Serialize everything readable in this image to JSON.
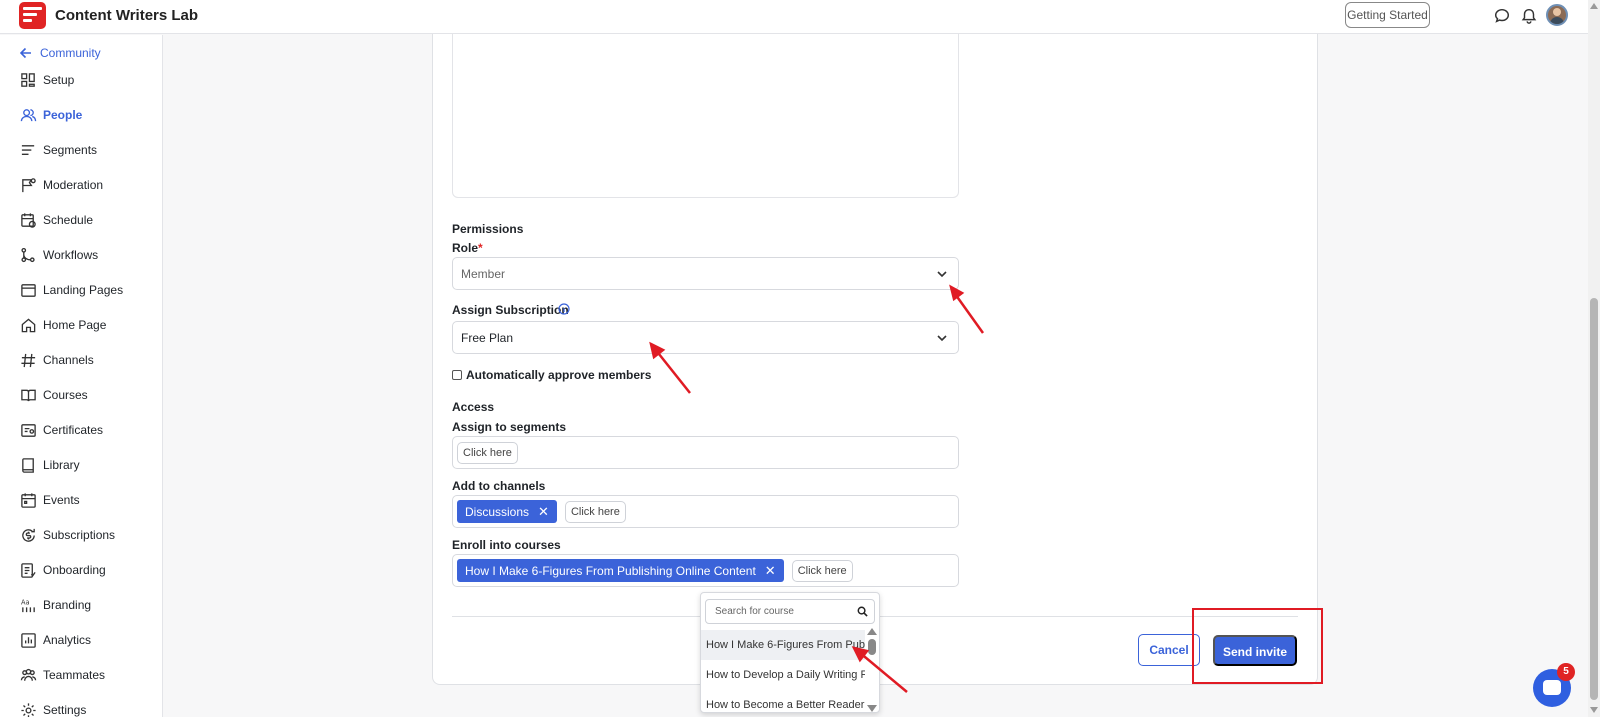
{
  "app": {
    "title": "Content Writers Lab"
  },
  "header": {
    "getting_started": "Getting Started"
  },
  "sidebar": {
    "back_label": "Community",
    "items": [
      {
        "label": "Setup",
        "icon": "grid-icon"
      },
      {
        "label": "People",
        "icon": "people-icon",
        "active": true
      },
      {
        "label": "Segments",
        "icon": "segments-icon"
      },
      {
        "label": "Moderation",
        "icon": "flag-icon"
      },
      {
        "label": "Schedule",
        "icon": "calendar-clock-icon"
      },
      {
        "label": "Workflows",
        "icon": "workflow-icon"
      },
      {
        "label": "Landing Pages",
        "icon": "browser-icon"
      },
      {
        "label": "Home Page",
        "icon": "home-icon"
      },
      {
        "label": "Channels",
        "icon": "hash-icon"
      },
      {
        "label": "Courses",
        "icon": "book-open-icon"
      },
      {
        "label": "Certificates",
        "icon": "certificate-icon"
      },
      {
        "label": "Library",
        "icon": "library-icon"
      },
      {
        "label": "Events",
        "icon": "calendar-icon"
      },
      {
        "label": "Subscriptions",
        "icon": "subscription-icon"
      },
      {
        "label": "Onboarding",
        "icon": "onboarding-icon"
      },
      {
        "label": "Branding",
        "icon": "branding-icon"
      },
      {
        "label": "Analytics",
        "icon": "analytics-icon"
      },
      {
        "label": "Teammates",
        "icon": "teammates-icon"
      },
      {
        "label": "Settings",
        "icon": "settings-icon"
      }
    ]
  },
  "form": {
    "permissions_heading": "Permissions",
    "role_label": "Role",
    "role_required": "*",
    "role_value": "Member",
    "subscription_label": "Assign Subscription",
    "subscription_value": "Free Plan",
    "auto_approve_label": "Automatically approve members",
    "auto_approve_checked": false,
    "access_heading": "Access",
    "segments_label": "Assign to segments",
    "segments_placeholder": "Click here",
    "channels_label": "Add to channels",
    "channels_chips": [
      "Discussions"
    ],
    "channels_placeholder": "Click here",
    "courses_label": "Enroll into courses",
    "courses_chips": [
      "How I Make 6-Figures From Publishing Online Content"
    ],
    "courses_placeholder": "Click here"
  },
  "dropdown": {
    "search_placeholder": "Search for course",
    "items": [
      "How I Make 6-Figures From Publi...",
      "How to Develop a Daily Writing R...",
      "How to Become a Better Reader"
    ]
  },
  "actions": {
    "cancel": "Cancel",
    "send_invite": "Send invite"
  },
  "chat": {
    "badge_count": "5"
  },
  "colors": {
    "accent": "#3b63d9",
    "annotation": "#e01b24"
  }
}
